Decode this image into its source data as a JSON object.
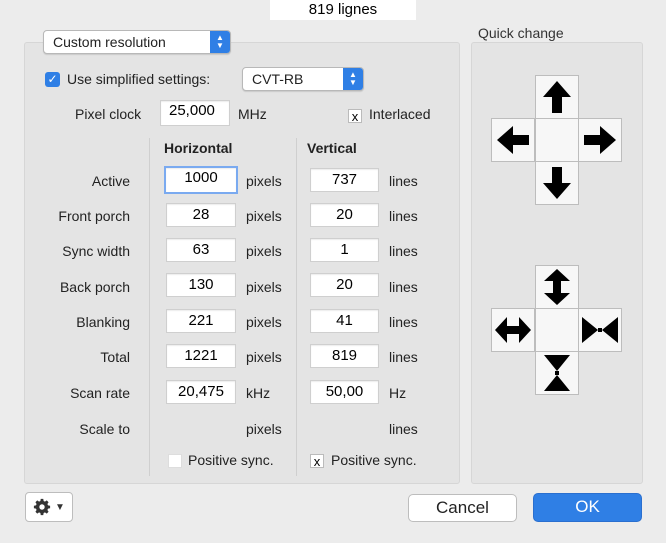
{
  "top_label": "819 lignes",
  "resolution_popup": "Custom resolution",
  "simplified": {
    "label": "Use simplified settings:",
    "checked": true,
    "mode": "CVT-RB"
  },
  "pixel_clock": {
    "label": "Pixel clock",
    "value": "25,000",
    "unit": "MHz"
  },
  "interlaced": {
    "label": "Interlaced",
    "mark": "x"
  },
  "headers": {
    "horizontal": "Horizontal",
    "vertical": "Vertical"
  },
  "rows": [
    {
      "label": "Active",
      "h": "1000",
      "h_unit": "pixels",
      "v": "737",
      "v_unit": "lines"
    },
    {
      "label": "Front porch",
      "h": "28",
      "h_unit": "pixels",
      "v": "20",
      "v_unit": "lines"
    },
    {
      "label": "Sync width",
      "h": "63",
      "h_unit": "pixels",
      "v": "1",
      "v_unit": "lines"
    },
    {
      "label": "Back porch",
      "h": "130",
      "h_unit": "pixels",
      "v": "20",
      "v_unit": "lines"
    },
    {
      "label": "Blanking",
      "h": "221",
      "h_unit": "pixels",
      "v": "41",
      "v_unit": "lines"
    },
    {
      "label": "Total",
      "h": "1221",
      "h_unit": "pixels",
      "v": "819",
      "v_unit": "lines"
    },
    {
      "label": "Scan rate",
      "h": "20,475",
      "h_unit": "kHz",
      "v": "50,00",
      "v_unit": "Hz"
    }
  ],
  "scale_to": {
    "label": "Scale to",
    "h_unit": "pixels",
    "v_unit": "lines"
  },
  "h_sync": {
    "label": "Positive sync.",
    "mark": ""
  },
  "v_sync": {
    "label": "Positive sync.",
    "mark": "x"
  },
  "quick_change": {
    "title": "Quick change"
  },
  "buttons": {
    "cancel": "Cancel",
    "ok": "OK"
  },
  "colors": {
    "accent": "#2f7fe5",
    "panel": "#e4e4e4",
    "window": "#ececec"
  }
}
